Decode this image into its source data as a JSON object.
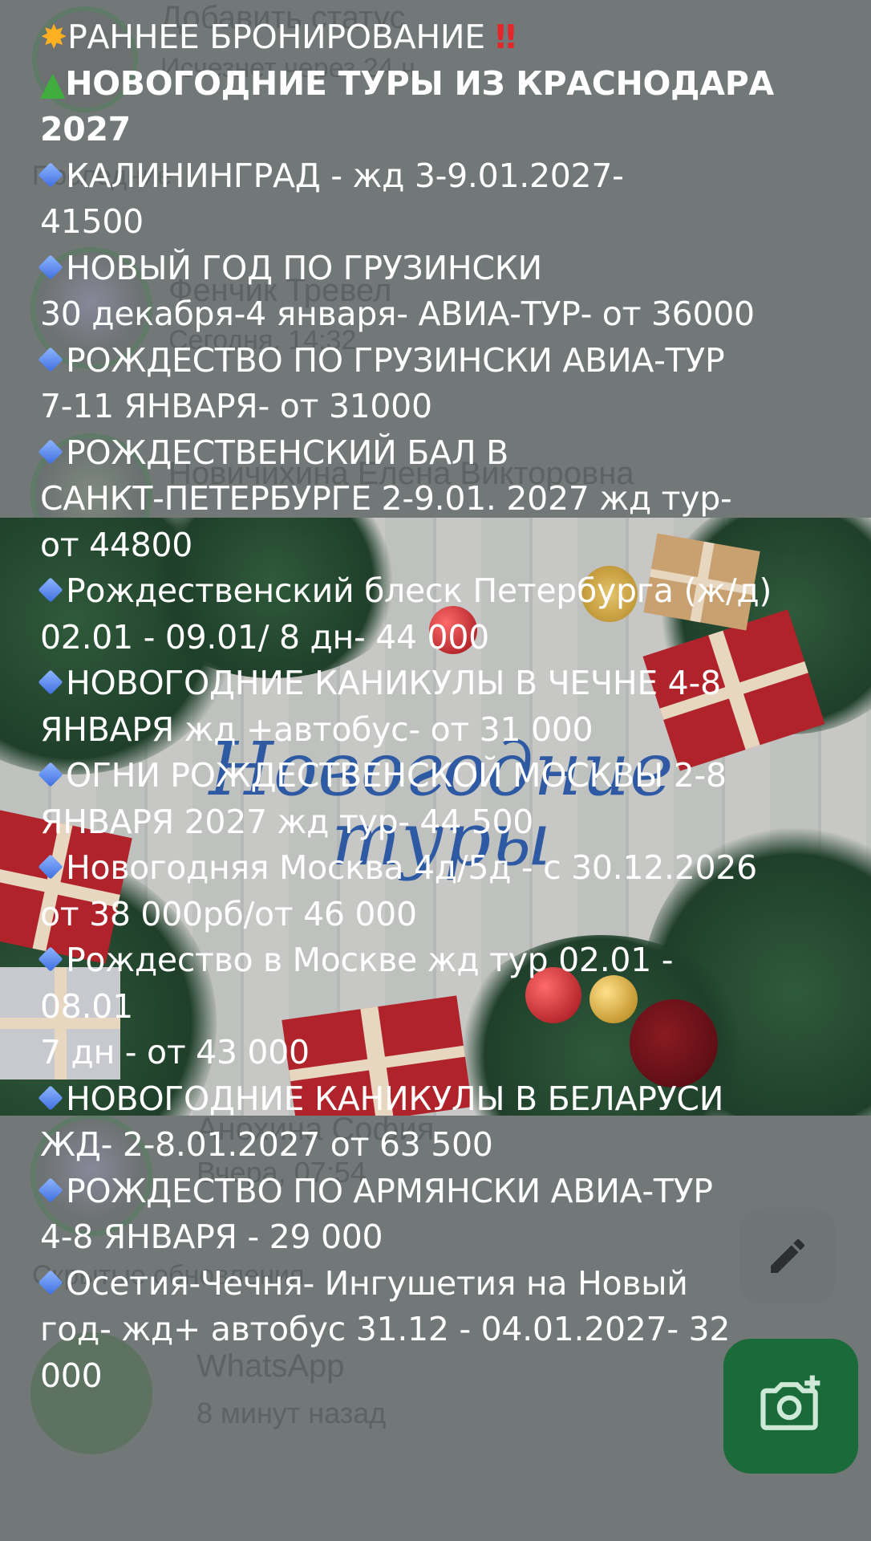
{
  "background": {
    "status_add_text": "Добавить статус",
    "status_time_text": "Исчезнет через 24 ч",
    "section_label": "Последние",
    "contact1_name": "Фенчик Тревел",
    "contact1_time": "Сегодня, 14:32",
    "contact2_name": "Новичихина Елена Викторовна",
    "contact3_name": "Анохина София",
    "contact3_time": "Вчера, 07:54",
    "hidden_label": "Скрытые обновления",
    "wa_name": "WhatsApp",
    "wa_time": "8 минут назад"
  },
  "banner": {
    "title_line1": "Новогодние",
    "title_line2": "туры"
  },
  "overlay_lines": [
    {
      "id": "l1",
      "text": "РАННЕЕ БРОНИРОВАНИЕ"
    },
    {
      "id": "l2",
      "text": "НОВОГОДНИЕ ТУРЫ ИЗ КРАСНОДАРА"
    },
    {
      "id": "l3",
      "text": "2027"
    },
    {
      "id": "l4",
      "text": "КАЛИНИНГРАД - жд  3-9.01.2027-"
    },
    {
      "id": "l5",
      "text": "41500"
    },
    {
      "id": "l6",
      "text": "НОВЫЙ ГОД ПО ГРУЗИНСКИ"
    },
    {
      "id": "l7",
      "text": "30 декабря-4 января- АВИА-ТУР- от 36000"
    },
    {
      "id": "l8",
      "text": "РОЖДЕСТВО ПО ГРУЗИНСКИ АВИА-ТУР"
    },
    {
      "id": "l9",
      "text": "7-11 ЯНВАРЯ- от 31000"
    },
    {
      "id": "l10",
      "text": "РОЖДЕСТВЕНСКИЙ БАЛ В"
    },
    {
      "id": "l11",
      "text": "САНКТ-ПЕТЕРБУРГЕ 2-9.01. 2027 жд тур-"
    },
    {
      "id": "l12",
      "text": "от 44800"
    },
    {
      "id": "l13",
      "text": "Рождественский блеск Петербурга (ж/д)"
    },
    {
      "id": "l14",
      "text": "02.01 - 09.01/ 8 дн- 44 000"
    },
    {
      "id": "l15",
      "text": "НОВОГОДНИЕ КАНИКУЛЫ В ЧЕЧНЕ 4-8"
    },
    {
      "id": "l16",
      "text": "ЯНВАРЯ жд +автобус- от 31 000"
    },
    {
      "id": "l17",
      "text": "ОГНИ РОЖДЕСТВЕНСКОЙ МОСКВЫ 2-8"
    },
    {
      "id": "l18",
      "text": "ЯНВАРЯ 2027 жд тур- 44 500"
    },
    {
      "id": "l19",
      "text": "Новогодняя Москва 4д/5д - с 30.12.2026"
    },
    {
      "id": "l20",
      "text": "от 38 000рб/от 46 000"
    },
    {
      "id": "l21",
      "text": "Рождество в Москве жд тур 02.01 -"
    },
    {
      "id": "l22",
      "text": "08.01"
    },
    {
      "id": "l23",
      "text": "7 дн - от 43 000"
    },
    {
      "id": "l24",
      "text": "НОВОГОДНИЕ КАНИКУЛЫ В БЕЛАРУСИ"
    },
    {
      "id": "l25",
      "text": "ЖД- 2-8.01.2027 от 63 500"
    },
    {
      "id": "l26",
      "text": "РОЖДЕСТВО ПО АРМЯНСКИ АВИА-ТУР"
    },
    {
      "id": "l27",
      "text": "4-8 ЯНВАРЯ - 29 000"
    },
    {
      "id": "l28",
      "text": "Осетия-Чечня- Ингушетия на Новый"
    },
    {
      "id": "l29",
      "text": "год- жд+ автобус 31.12 - 04.01.2027- 32"
    },
    {
      "id": "l30",
      "text": "000"
    }
  ],
  "icons": {
    "boom": "collision-emoji",
    "tree": "christmas-tree-emoji",
    "diamond": "blue-diamond-emoji",
    "exclamation": "double-exclamation-emoji",
    "pencil": "pencil-icon",
    "camera": "camera-plus-icon"
  },
  "colors": {
    "text": "#ffffff",
    "banner_title": "#1f4fa0",
    "camera_button": "#1b6a3a",
    "exclamation": "#e3262a"
  }
}
